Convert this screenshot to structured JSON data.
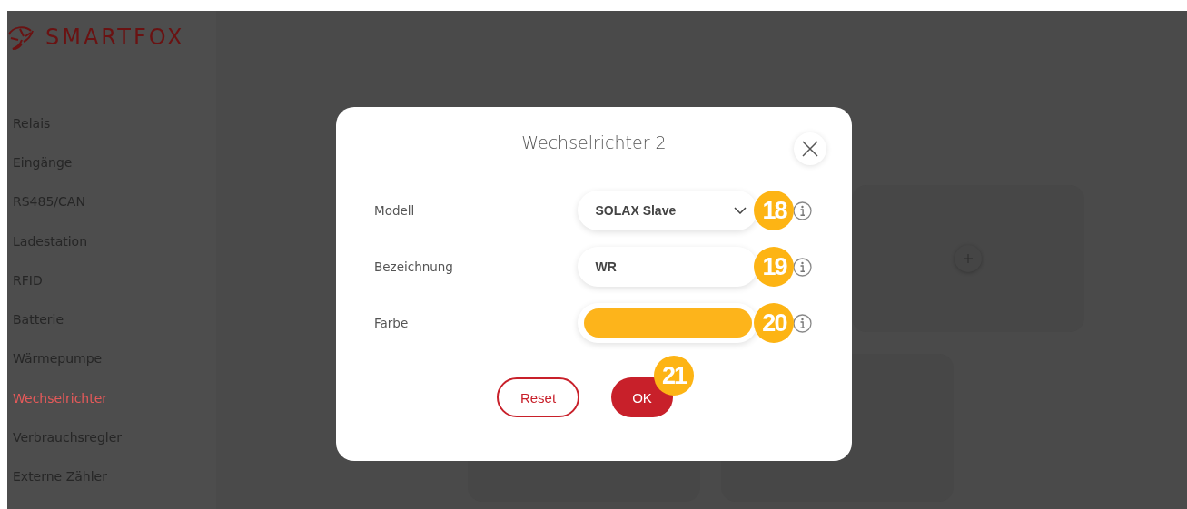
{
  "logo": {
    "text": "SMARTFOX"
  },
  "sidebar": {
    "items": [
      {
        "label": "Relais",
        "selected": false
      },
      {
        "label": "Eingänge",
        "selected": false
      },
      {
        "label": "RS485/CAN",
        "selected": false
      },
      {
        "label": "Ladestation",
        "selected": false
      },
      {
        "label": "RFID",
        "selected": false
      },
      {
        "label": "Batterie",
        "selected": false
      },
      {
        "label": "Wärmepumpe",
        "selected": false
      },
      {
        "label": "Wechselrichter",
        "selected": true
      },
      {
        "label": "Verbrauchsregler",
        "selected": false
      },
      {
        "label": "Externe Zähler",
        "selected": false
      }
    ]
  },
  "cards": [
    {
      "kind": "add"
    },
    {
      "kind": "empty"
    },
    {
      "kind": "empty"
    }
  ],
  "dialog": {
    "title": "Wechselrichter 2",
    "fields": [
      {
        "kind": "select",
        "label": "Modell",
        "value": "SOLAX Slave",
        "badge": "18"
      },
      {
        "kind": "text",
        "label": "Bezeichnung",
        "value": "WR",
        "badge": "19"
      },
      {
        "kind": "color",
        "label": "Farbe",
        "color": "#fdb41b",
        "badge": "20"
      }
    ],
    "buttons": [
      {
        "kind": "outline",
        "label": "Reset"
      },
      {
        "kind": "primary",
        "label": "OK",
        "badge": "21"
      }
    ]
  }
}
